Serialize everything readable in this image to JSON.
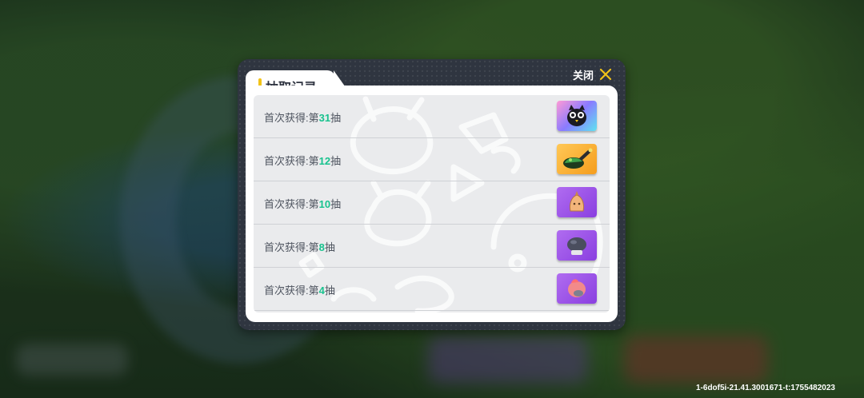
{
  "dialog": {
    "title": "抽取记录",
    "close_label": "关闭"
  },
  "records": [
    {
      "prefix": "首次获得:第",
      "number": "31",
      "suffix": "抽",
      "item_icon": "owl-badge-icon",
      "rarity_color": "#5fd8ef"
    },
    {
      "prefix": "首次获得:第",
      "number": "12",
      "suffix": "抽",
      "item_icon": "flame-cannon-icon",
      "rarity_color": "#f5a623"
    },
    {
      "prefix": "首次获得:第",
      "number": "10",
      "suffix": "抽",
      "item_icon": "seed-bag-icon",
      "rarity_color": "#9b4fe0"
    },
    {
      "prefix": "首次获得:第",
      "number": "8",
      "suffix": "抽",
      "item_icon": "rock-bun-icon",
      "rarity_color": "#9b4fe0"
    },
    {
      "prefix": "首次获得:第",
      "number": "4",
      "suffix": "抽",
      "item_icon": "peach-mochi-icon",
      "rarity_color": "#9b4fe0"
    }
  ],
  "footer": {
    "build_id": "1-6dof5i-21.41.3001671-t:1755482023"
  },
  "colors": {
    "accent": "#f2c318",
    "number": "#18c28e",
    "panel": "#eaebed",
    "frame": "#2f3540"
  }
}
